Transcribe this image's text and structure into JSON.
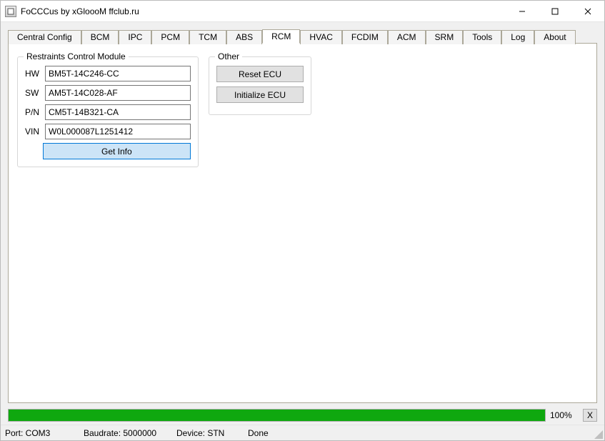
{
  "window": {
    "title": "FoCCCus by xGloooM ffclub.ru"
  },
  "tabs": [
    {
      "id": "central",
      "label": "Central Config"
    },
    {
      "id": "bcm",
      "label": "BCM"
    },
    {
      "id": "ipc",
      "label": "IPC"
    },
    {
      "id": "pcm",
      "label": "PCM"
    },
    {
      "id": "tcm",
      "label": "TCM"
    },
    {
      "id": "abs",
      "label": "ABS"
    },
    {
      "id": "rcm",
      "label": "RCM",
      "active": true
    },
    {
      "id": "hvac",
      "label": "HVAC"
    },
    {
      "id": "fcdim",
      "label": "FCDIM"
    },
    {
      "id": "acm",
      "label": "ACM"
    },
    {
      "id": "srm",
      "label": "SRM"
    },
    {
      "id": "tools",
      "label": "Tools"
    },
    {
      "id": "log",
      "label": "Log"
    },
    {
      "id": "about",
      "label": "About"
    }
  ],
  "rcm": {
    "group_title": "Restraints Control Module",
    "labels": {
      "hw": "HW",
      "sw": "SW",
      "pn": "P/N",
      "vin": "VIN"
    },
    "values": {
      "hw": "BM5T-14C246-CC",
      "sw": "AM5T-14C028-AF",
      "pn": "CM5T-14B321-CA",
      "vin": "W0L000087L1251412"
    },
    "get_info_label": "Get Info"
  },
  "other": {
    "group_title": "Other",
    "reset_label": "Reset ECU",
    "initialize_label": "Initialize ECU"
  },
  "progress": {
    "percent": 100,
    "percent_text": "100%",
    "cancel_label": "X"
  },
  "status": {
    "port": "Port: COM3",
    "baudrate": "Baudrate: 5000000",
    "device": "Device: STN",
    "state": "Done"
  }
}
